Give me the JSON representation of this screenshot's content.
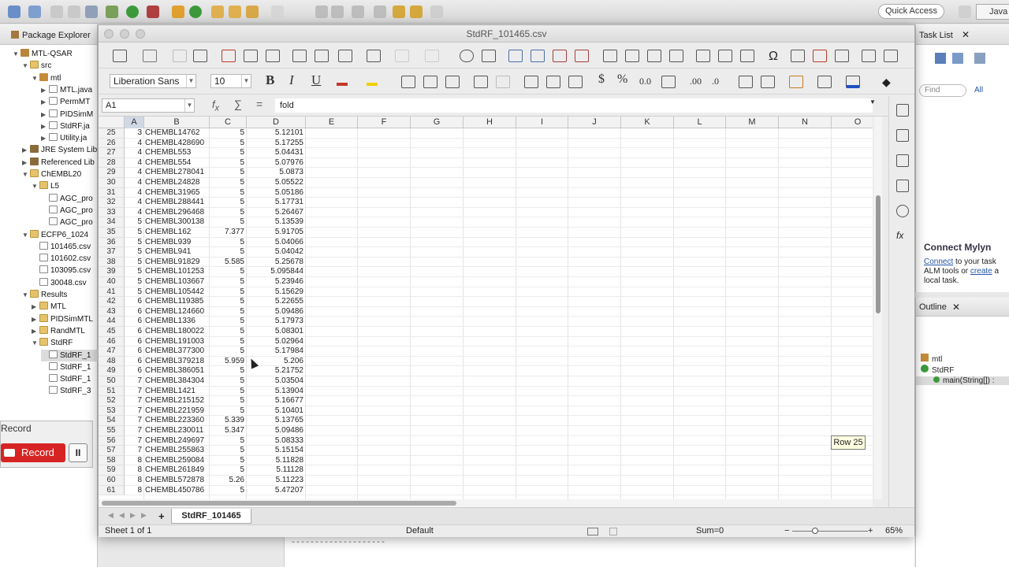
{
  "eclipse": {
    "quick_access": "Quick Access",
    "perspective": "Java"
  },
  "package_explorer": {
    "title": "Package Explorer",
    "items": [
      {
        "label": "MTL-QSAR",
        "tri": "▼",
        "icon": "project-icon"
      },
      {
        "label": "src",
        "tri": "▼",
        "icon": "folder-icon"
      },
      {
        "label": "mtl",
        "tri": "▼",
        "icon": "package-icon"
      },
      {
        "label": "MTL.java",
        "tri": "▶",
        "icon": "java-file-icon"
      },
      {
        "label": "PermMT",
        "tri": "▶",
        "icon": "java-file-icon"
      },
      {
        "label": "PIDSimM",
        "tri": "▶",
        "icon": "java-file-icon"
      },
      {
        "label": "StdRF.ja",
        "tri": "▶",
        "icon": "java-file-icon"
      },
      {
        "label": "Utility.ja",
        "tri": "▶",
        "icon": "java-file-icon"
      },
      {
        "label": "JRE System Lib",
        "tri": "▶",
        "icon": "library-icon"
      },
      {
        "label": "Referenced Lib",
        "tri": "▶",
        "icon": "library-icon"
      },
      {
        "label": "ChEMBL20",
        "tri": "▼",
        "icon": "folder-icon"
      },
      {
        "label": "L5",
        "tri": "▼",
        "icon": "folder-icon"
      },
      {
        "label": "AGC_pro",
        "tri": "",
        "icon": "file-icon"
      },
      {
        "label": "AGC_pro",
        "tri": "",
        "icon": "file-icon"
      },
      {
        "label": "AGC_pro",
        "tri": "",
        "icon": "file-icon"
      },
      {
        "label": "ECFP6_1024",
        "tri": "▼",
        "icon": "folder-icon"
      },
      {
        "label": "101465.csv",
        "tri": "",
        "icon": "file-icon"
      },
      {
        "label": "101602.csv",
        "tri": "",
        "icon": "file-icon"
      },
      {
        "label": "103095.csv",
        "tri": "",
        "icon": "file-icon"
      },
      {
        "label": "30048.csv",
        "tri": "",
        "icon": "file-icon"
      },
      {
        "label": "Results",
        "tri": "▼",
        "icon": "folder-icon"
      },
      {
        "label": "MTL",
        "tri": "▶",
        "icon": "folder-icon"
      },
      {
        "label": "PIDSimMTL",
        "tri": "▶",
        "icon": "folder-icon"
      },
      {
        "label": "RandMTL",
        "tri": "▶",
        "icon": "folder-icon"
      },
      {
        "label": "StdRF",
        "tri": "▼",
        "icon": "folder-icon"
      },
      {
        "label": "StdRF_1",
        "tri": "",
        "icon": "file-icon"
      },
      {
        "label": "StdRF_1",
        "tri": "",
        "icon": "file-icon"
      },
      {
        "label": "StdRF_1",
        "tri": "",
        "icon": "file-icon"
      },
      {
        "label": "StdRF_3",
        "tri": "",
        "icon": "file-icon"
      }
    ]
  },
  "record": {
    "title": "Record",
    "button_label": "Record",
    "pause_label": "II"
  },
  "task_list": {
    "title": "Task List",
    "find_placeholder": "Find",
    "all_label": "All",
    "mylyn_title": "Connect Mylyn",
    "mylyn_connect": "Connect",
    "mylyn_text1": " to your task ALM tools or ",
    "mylyn_create": "create",
    "mylyn_text2": " a local task."
  },
  "outline": {
    "title": "Outline",
    "items": [
      "mtl",
      "StdRF",
      "main(String[]) :"
    ]
  },
  "editor_bottom": {
    "dashes": "--------------------"
  },
  "calc": {
    "window_title": "StdRF_101465.csv",
    "font_name": "Liberation Sans",
    "font_size": "10",
    "name_box": "A1",
    "formula_value": "fold",
    "columns": [
      "A",
      "B",
      "C",
      "D",
      "E",
      "F",
      "G",
      "H",
      "I",
      "J",
      "K",
      "L",
      "M",
      "N",
      "O"
    ],
    "rows": [
      [
        "25",
        "3",
        "CHEMBL14762",
        "5",
        "5.12101"
      ],
      [
        "26",
        "4",
        "CHEMBL428690",
        "5",
        "5.17255"
      ],
      [
        "27",
        "4",
        "CHEMBL553",
        "5",
        "5.04431"
      ],
      [
        "28",
        "4",
        "CHEMBL554",
        "5",
        "5.07976"
      ],
      [
        "29",
        "4",
        "CHEMBL278041",
        "5",
        "5.0873"
      ],
      [
        "30",
        "4",
        "CHEMBL24828",
        "5",
        "5.05522"
      ],
      [
        "31",
        "4",
        "CHEMBL31965",
        "5",
        "5.05186"
      ],
      [
        "32",
        "4",
        "CHEMBL288441",
        "5",
        "5.17731"
      ],
      [
        "33",
        "4",
        "CHEMBL296468",
        "5",
        "5.26467"
      ],
      [
        "34",
        "5",
        "CHEMBL300138",
        "5",
        "5.13539"
      ],
      [
        "35",
        "5",
        "CHEMBL162",
        "7.377",
        "5.91705"
      ],
      [
        "36",
        "5",
        "CHEMBL939",
        "5",
        "5.04066"
      ],
      [
        "37",
        "5",
        "CHEMBL941",
        "5",
        "5.04042"
      ],
      [
        "38",
        "5",
        "CHEMBL91829",
        "5.585",
        "5.25678"
      ],
      [
        "39",
        "5",
        "CHEMBL101253",
        "5",
        "5.095844"
      ],
      [
        "40",
        "5",
        "CHEMBL103667",
        "5",
        "5.23946"
      ],
      [
        "41",
        "5",
        "CHEMBL105442",
        "5",
        "5.15629"
      ],
      [
        "42",
        "6",
        "CHEMBL119385",
        "5",
        "5.22655"
      ],
      [
        "43",
        "6",
        "CHEMBL124660",
        "5",
        "5.09486"
      ],
      [
        "44",
        "6",
        "CHEMBL1336",
        "5",
        "5.17973"
      ],
      [
        "45",
        "6",
        "CHEMBL180022",
        "5",
        "5.08301"
      ],
      [
        "46",
        "6",
        "CHEMBL191003",
        "5",
        "5.02964"
      ],
      [
        "47",
        "6",
        "CHEMBL377300",
        "5",
        "5.17984"
      ],
      [
        "48",
        "6",
        "CHEMBL379218",
        "5.959",
        "5.206"
      ],
      [
        "49",
        "6",
        "CHEMBL386051",
        "5",
        "5.21752"
      ],
      [
        "50",
        "7",
        "CHEMBL384304",
        "5",
        "5.03504"
      ],
      [
        "51",
        "7",
        "CHEMBL1421",
        "5",
        "5.13904"
      ],
      [
        "52",
        "7",
        "CHEMBL215152",
        "5",
        "5.16677"
      ],
      [
        "53",
        "7",
        "CHEMBL221959",
        "5",
        "5.10401"
      ],
      [
        "54",
        "7",
        "CHEMBL223360",
        "5.339",
        "5.13765"
      ],
      [
        "55",
        "7",
        "CHEMBL230011",
        "5.347",
        "5.09486"
      ],
      [
        "56",
        "7",
        "CHEMBL249697",
        "5",
        "5.08333"
      ],
      [
        "57",
        "7",
        "CHEMBL255863",
        "5",
        "5.15154"
      ],
      [
        "58",
        "8",
        "CHEMBL259084",
        "5",
        "5.11828"
      ],
      [
        "59",
        "8",
        "CHEMBL261849",
        "5",
        "5.11128"
      ],
      [
        "60",
        "8",
        "CHEMBL572878",
        "5.26",
        "5.11223"
      ],
      [
        "61",
        "8",
        "CHEMBL450786",
        "5",
        "5.47207"
      ]
    ],
    "sheet_tab": "StdRF_101465",
    "add_sheet": "+",
    "status": {
      "sheet": "Sheet 1 of 1",
      "style": "Default",
      "sum": "Sum=0",
      "zoom": "65%"
    },
    "tooltip": "Row 25"
  }
}
